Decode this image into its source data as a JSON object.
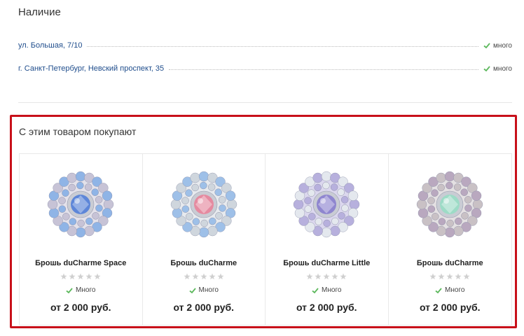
{
  "availability": {
    "title": "Наличие",
    "rows": [
      {
        "address": "ул. Большая, 7/10",
        "stock": "много"
      },
      {
        "address": "г. Санкт-Петербург, Невский проспект, 35",
        "stock": "много"
      }
    ]
  },
  "also_buy": {
    "title": "С этим товаром покупают",
    "products": [
      {
        "name": "Брошь duCharme Space",
        "availability": "Много",
        "price": "от 2 000 руб.",
        "rating": 0,
        "colors": {
          "outer": "#8fb4e6",
          "mid": "#c7c3d6",
          "center": "#5d86d8"
        }
      },
      {
        "name": "Брошь duCharme",
        "availability": "Много",
        "price": "от 2 000 руб.",
        "rating": 0,
        "colors": {
          "outer": "#9ec0e8",
          "mid": "#cfd6dd",
          "center": "#e58aa0"
        }
      },
      {
        "name": "Брошь duCharme Little",
        "availability": "Много",
        "price": "от 2 000 руб.",
        "rating": 0,
        "colors": {
          "outer": "#e4e8ee",
          "mid": "#b7b0dd",
          "center": "#8f86cf"
        }
      },
      {
        "name": "Брошь duCharme",
        "availability": "Много",
        "price": "от 2 000 руб.",
        "rating": 0,
        "colors": {
          "outer": "#b9a8bf",
          "mid": "#c9c1c5",
          "center": "#9ddbc6"
        }
      }
    ]
  },
  "colors": {
    "accent_border": "#c8101a",
    "link": "#1f4d8c",
    "check": "#5cb85c",
    "star": "#d0d0d0"
  },
  "icons": {
    "check": "check-icon",
    "star": "star-icon"
  }
}
